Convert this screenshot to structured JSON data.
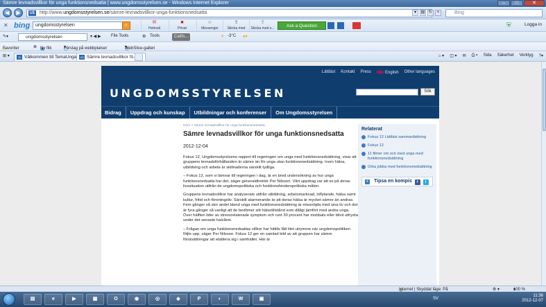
{
  "window": {
    "title": "Sämre levnadsvillkor för unga funktionsnedsatta | www.ungdomsstyrelsen.se - Windows Internet Explorer"
  },
  "address": {
    "scheme": "http://www.",
    "domain": "ungdomsstyrelsen.se",
    "path": "/sämre-levnadsvillkor-unga-funktionsnedsatta",
    "search_placeholder": "Bing"
  },
  "bing_toolbar": {
    "logo": "bing",
    "query": "ungdomsstyrelsen",
    "tools": [
      "Hotmail",
      "Privat",
      "Messenger",
      "Skicka med",
      "Skicka med s..."
    ],
    "ask_button": "Ask a Question",
    "login": "Logga in"
  },
  "toolbar2": {
    "query": "ungdomsstyrelsen",
    "file_tools": "File Tools",
    "tools": "Tools",
    "search_box": "Califo...",
    "temperature": "-3°C"
  },
  "favorites": {
    "label": "Favoriter",
    "items": [
      "Ny flik",
      "Förslag på webbplatser",
      "WebSlice-galleri"
    ]
  },
  "tabs": [
    {
      "label": "Välkommen till TemaUnga...",
      "active": false
    },
    {
      "label": "Sämre levnadsvillkor fö...",
      "active": true
    }
  ],
  "command_bar": [
    "Sida",
    "Säkerhet",
    "Verktyg"
  ],
  "site": {
    "top_links": [
      "Lättläst",
      "Kontakt",
      "Press",
      "English",
      "Other languages"
    ],
    "logo": "UNGDOMSSTYRELSEN",
    "search_button": "Sök",
    "nav": [
      "Bidrag",
      "Uppdrag och kunskap",
      "Utbildningar och konferenser",
      "Om Ungdomsstyrelsen"
    ],
    "breadcrumb": "Hem > Sämre levnadsvillkor för unga funktionsnedsatta",
    "title": "Sämre levnadsvillkor för unga funktionsnedsatta",
    "date": "2012-12-04",
    "paragraphs": [
      "Fokus 12, Ungdomsstyrelsens rapport till regeringen om unga med funktionsnedsättning, visar att gruppens levnadsförhållanden är sämre än för unga utan funktionsnedsättning. Inom hälsa, utbildning och arbete är skillnaderna särskilt tydliga.",
      "– Fokus 12, som vi lämnar till regeringen i dag, är en bred undersökning av hur unga funktionsnedsatta har det, säger generaldirektör Per Nilsson. Vårt uppdrag var att se på deras livssituation utifrån de ungdomspolitiska och funktionshinderspolitiska målen.",
      "Gruppens levnadsvillkor har analyserats utifrån utbildning, arbetsmarknad, inflytande, hälsa samt kultur, fritid och föreningsliv. Särskilt alarmerande är att deras hälsa är mycket sämre än andras. Fem gånger så stor andel bland unga med funktionsnedsättning är missnöjda med sina liv och det är fyra gånger så vanligt att de bedömer sitt hälsotillstånd som dåligt jämfört med andra unga. Över hälften lider av stressrelaterade symptom och runt 30 procent har mobbats eller blivit utfrysta under det senaste halvåret.",
      "– Frågan om unga funktionsnedsattas villkor har hittills fått litet utrymme när ungdomspolitiken följts upp, säger Per Nilsson. Fokus 12 ger en samlad bild av att gruppen har sämre förutsättningar att etablera sig i samhället. Här är"
    ],
    "related_heading": "Relaterat",
    "related": [
      "Fokus 12 Lättläst sammanfattning",
      "Fokus 12",
      "11 filmer om och med unga med funktionsnedsättning",
      "Orka jobba med funktionsnedsättning"
    ],
    "tips": "Tipsa en kompis"
  },
  "statusbar": {
    "zone": "Internet | Skyddat läge: På",
    "zoom": "100 %"
  },
  "taskbar": {
    "lang": "SV",
    "time": "11:36",
    "date": "2012-12-07"
  }
}
